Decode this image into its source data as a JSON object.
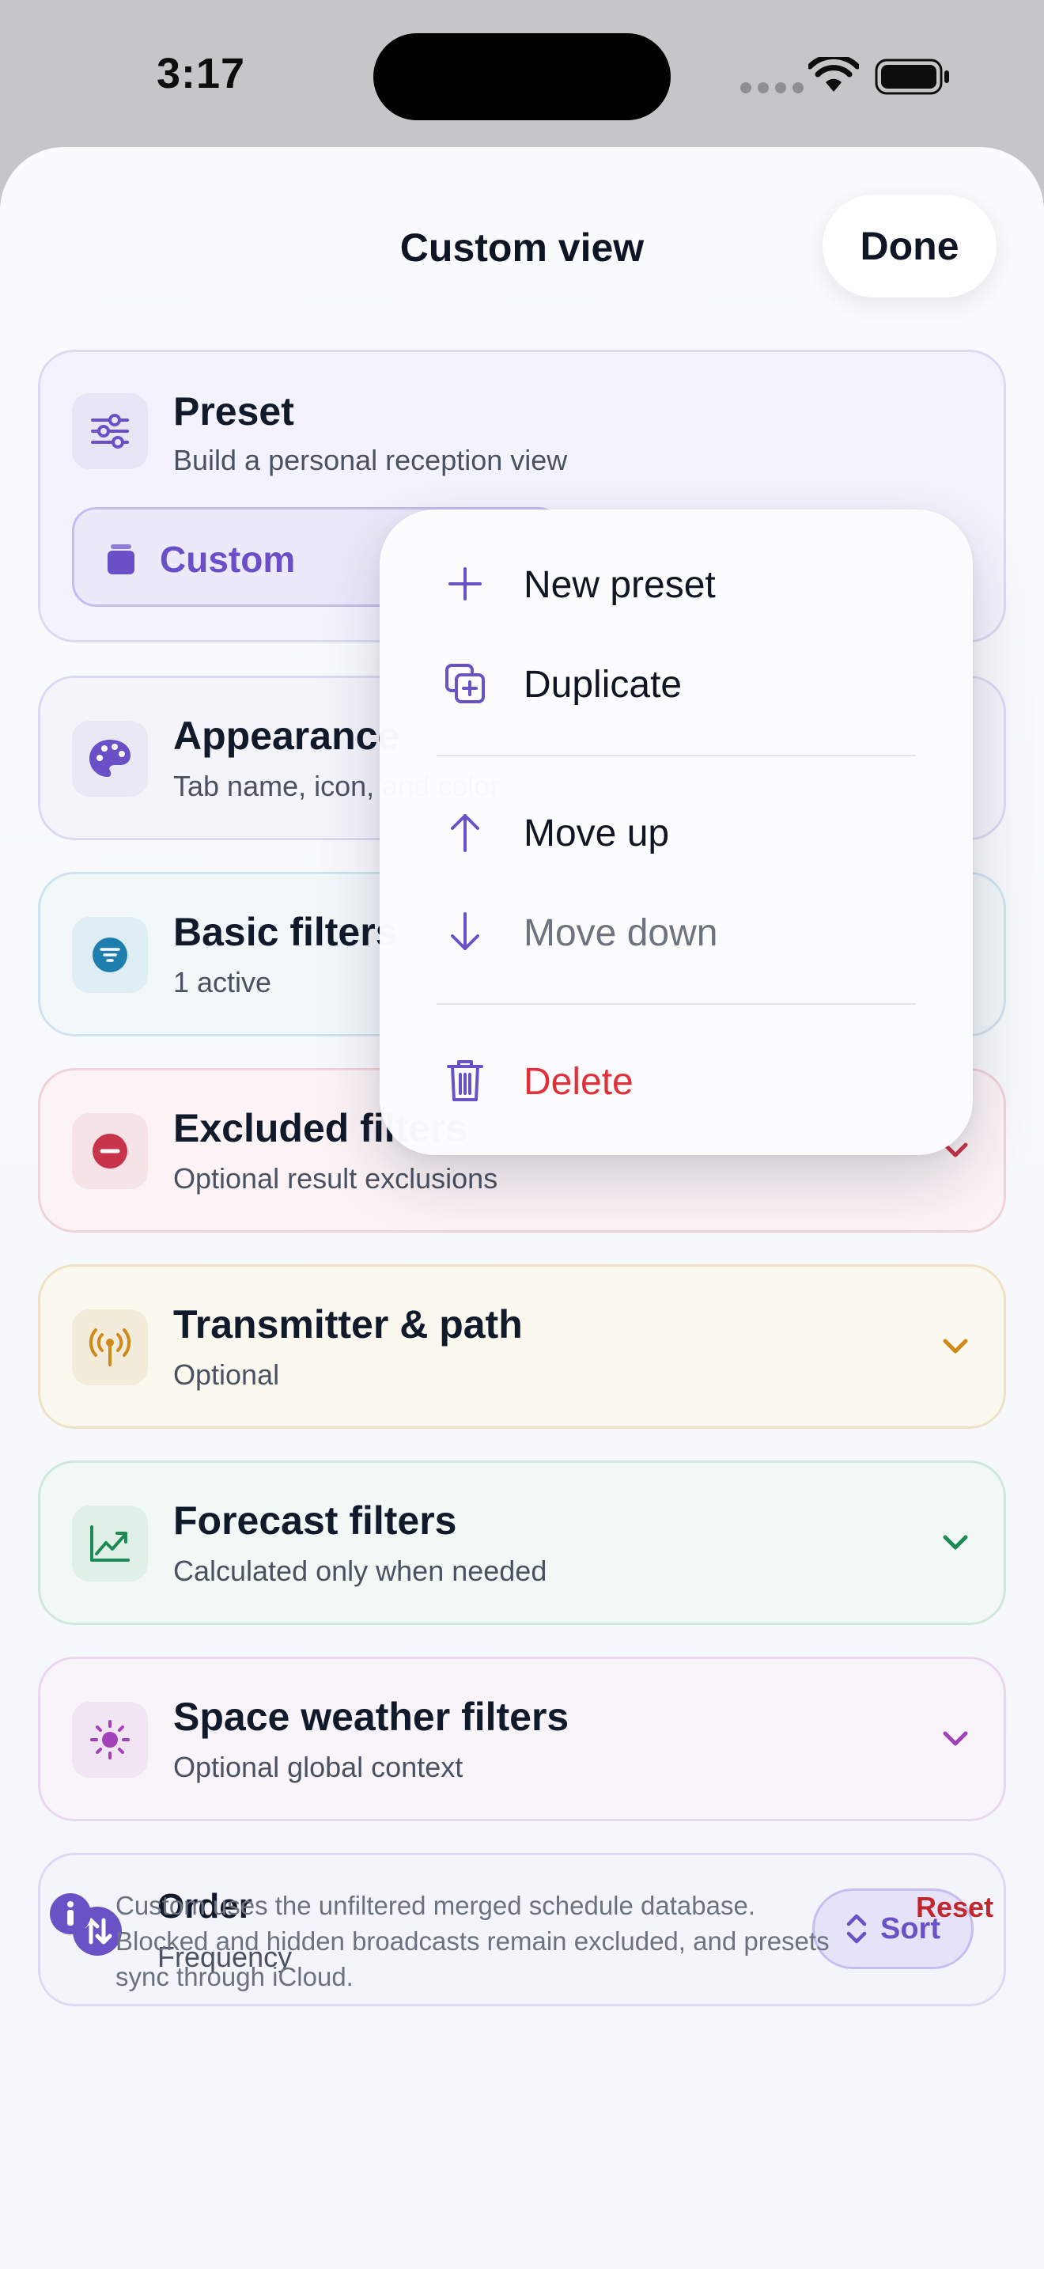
{
  "status": {
    "time": "3:17"
  },
  "header": {
    "title": "Custom view",
    "done_label": "Done"
  },
  "preset": {
    "title": "Preset",
    "subtitle": "Build a personal reception view",
    "selected": "Custom"
  },
  "cards": {
    "appearance": {
      "title": "Appearance",
      "subtitle": "Tab name, icon, and color",
      "accent": "#6b4fc9"
    },
    "basic": {
      "title": "Basic filters",
      "subtitle": "1 active",
      "accent": "#1e7fae"
    },
    "excluded": {
      "title": "Excluded filters",
      "subtitle": "Optional result exclusions",
      "accent": "#c8344a"
    },
    "transmitter": {
      "title": "Transmitter & path",
      "subtitle": "Optional",
      "accent": "#d08a1a"
    },
    "forecast": {
      "title": "Forecast filters",
      "subtitle": "Calculated only when needed",
      "accent": "#1d8a55"
    },
    "space": {
      "title": "Space weather filters",
      "subtitle": "Optional global context",
      "accent": "#a241b8"
    }
  },
  "order": {
    "title": "Order",
    "value": "Frequency",
    "sort_label": "Sort"
  },
  "footer": {
    "note": "Custom uses the unfiltered merged schedule database. Blocked and hidden broadcasts remain excluded, and presets sync through iCloud.",
    "reset_label": "Reset"
  },
  "menu": {
    "new_preset": "New preset",
    "duplicate": "Duplicate",
    "move_up": "Move up",
    "move_down": "Move down",
    "delete": "Delete",
    "delete_color": "#e0313a",
    "disabled_color": "#6e7380"
  }
}
